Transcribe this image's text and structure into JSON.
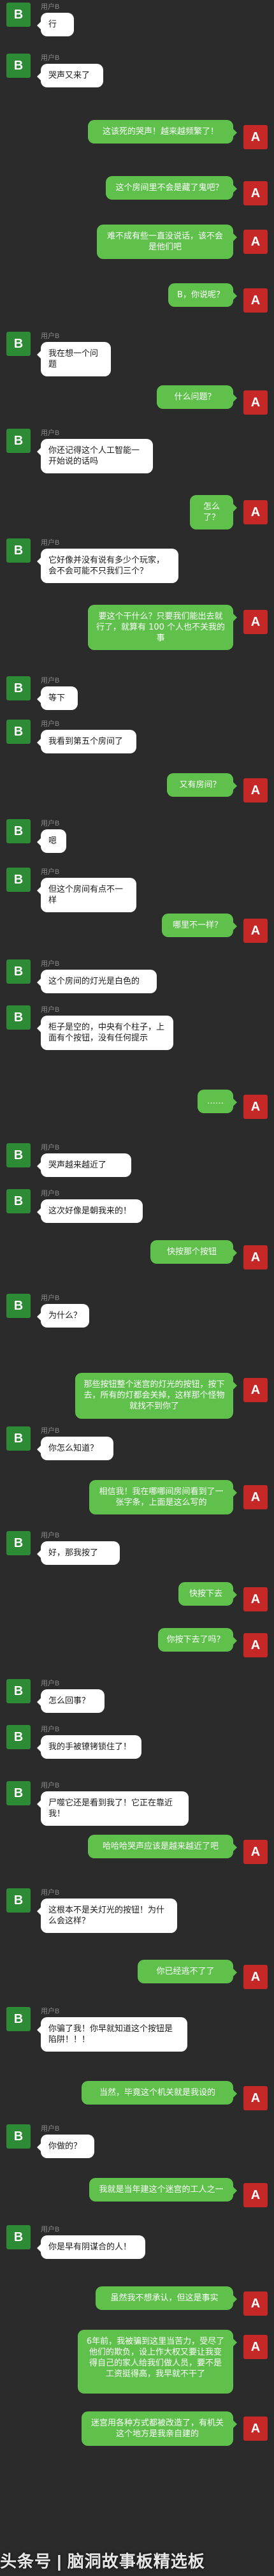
{
  "colors": {
    "background": "#2b2b2b",
    "left_avatar": "#2d8a35",
    "right_avatar": "#c62828",
    "right_bubble": "#5fc04c",
    "left_bubble": "#ffffff"
  },
  "messages": [
    {
      "side": "left",
      "avatar": "B",
      "name": "用户B",
      "text": "行"
    },
    {
      "side": "left",
      "avatar": "B",
      "name": "用户B",
      "text": "哭声又来了"
    },
    {
      "side": "right",
      "avatar": "A",
      "text": "这该死的哭声！越来越频繁了！"
    },
    {
      "side": "right",
      "avatar": "A",
      "text": "这个房间里不会是藏了鬼吧？"
    },
    {
      "side": "right",
      "avatar": "A",
      "text": "难不成有些一直没说话，该不会是他们吧"
    },
    {
      "side": "right",
      "avatar": "A",
      "text": "B，你说呢？"
    },
    {
      "side": "left",
      "avatar": "B",
      "name": "用户B",
      "text": "我在想一个问题"
    },
    {
      "side": "right",
      "avatar": "A",
      "text": "什么问题？"
    },
    {
      "side": "left",
      "avatar": "B",
      "name": "用户B",
      "text": "你还记得这个人工智能一开始说的话吗"
    },
    {
      "side": "right",
      "avatar": "A",
      "text": "怎么了？"
    },
    {
      "side": "left",
      "avatar": "B",
      "name": "用户B",
      "text": "它好像并没有说有多少个玩家，会不会可能不只我们三个？"
    },
    {
      "side": "right",
      "avatar": "A",
      "text": "要这个干什么？只要我们能出去就行了，就算有 100 个人也不关我的事"
    },
    {
      "side": "left",
      "avatar": "B",
      "name": "用户B",
      "text": "等下"
    },
    {
      "side": "left",
      "avatar": "B",
      "name": "用户B",
      "text": "我看到第五个房间了"
    },
    {
      "side": "right",
      "avatar": "A",
      "text": "又有房间？"
    },
    {
      "side": "left",
      "avatar": "B",
      "name": "用户B",
      "text": "嗯"
    },
    {
      "side": "left",
      "avatar": "B",
      "name": "用户B",
      "text": "但这个房间有点不一样"
    },
    {
      "side": "right",
      "avatar": "A",
      "text": "哪里不一样？"
    },
    {
      "side": "left",
      "avatar": "B",
      "name": "用户B",
      "text": "这个房间的灯光是白色的"
    },
    {
      "side": "left",
      "avatar": "B",
      "name": "用户B",
      "text": "柜子是空的，中央有个柱子，上面有个按钮，没有任何提示"
    },
    {
      "side": "right",
      "avatar": "A",
      "text": "……"
    },
    {
      "side": "left",
      "avatar": "B",
      "name": "用户B",
      "text": "哭声越来越近了"
    },
    {
      "side": "left",
      "avatar": "B",
      "name": "用户B",
      "text": "这次好像是朝我来的！"
    },
    {
      "side": "right",
      "avatar": "A",
      "text": "快按那个按钮"
    },
    {
      "side": "left",
      "avatar": "B",
      "name": "用户B",
      "text": "为什么？"
    },
    {
      "side": "right",
      "avatar": "A",
      "text": "那些按钮整个迷宫的灯光的按钮，按下去，所有的灯都会关掉，这样那个怪物就找不到你了"
    },
    {
      "side": "left",
      "avatar": "B",
      "name": "用户B",
      "text": "你怎么知道？"
    },
    {
      "side": "right",
      "avatar": "A",
      "text": "相信我！我在哪哪间房间看到了一张字条，上面是这么写的"
    },
    {
      "side": "left",
      "avatar": "B",
      "name": "用户B",
      "text": "好，那我按了"
    },
    {
      "side": "right",
      "avatar": "A",
      "text": "快按下去"
    },
    {
      "side": "right",
      "avatar": "A",
      "text": "你按下去了吗？"
    },
    {
      "side": "left",
      "avatar": "B",
      "name": "用户B",
      "text": "怎么回事？"
    },
    {
      "side": "left",
      "avatar": "B",
      "name": "用户B",
      "text": "我的手被镣铐锁住了！"
    },
    {
      "side": "left",
      "avatar": "B",
      "name": "用户B",
      "text": "尸噬它还是看到我了！它正在靠近我！"
    },
    {
      "side": "right",
      "avatar": "A",
      "text": "哈哈哈哭声应该是越来越近了吧"
    },
    {
      "side": "left",
      "avatar": "B",
      "name": "用户B",
      "text": "这根本不是关灯光的按钮！为什么会这样？"
    },
    {
      "side": "right",
      "avatar": "A",
      "text": "你已经逃不了了"
    },
    {
      "side": "left",
      "avatar": "B",
      "name": "用户B",
      "text": "你骗了我！你早就知道这个按钮是陷阱！！！"
    },
    {
      "side": "right",
      "avatar": "A",
      "text": "当然，毕竟这个机关就是我设的"
    },
    {
      "side": "left",
      "avatar": "B",
      "name": "用户B",
      "text": "你做的？"
    },
    {
      "side": "right",
      "avatar": "A",
      "text": "我就是当年建这个迷宫的工人之一"
    },
    {
      "side": "left",
      "avatar": "B",
      "name": "用户B",
      "text": "你是早有阴谋合的人！"
    },
    {
      "side": "right",
      "avatar": "A",
      "text": "虽然我不想承认，但这是事实"
    },
    {
      "side": "right",
      "avatar": "A",
      "text": "6年前，我被骗到这里当苦力，受尽了他们的欺负，设上作大权又要让我变得自己的家人给我们做人员，要不是工资挺得高，我早就不干了"
    },
    {
      "side": "right",
      "avatar": "A",
      "text": "迷宫用各种方式都被改造了，有机关这个地方是我亲自建的"
    }
  ],
  "watermark": "头条号 | 脑洞故事板精选板"
}
